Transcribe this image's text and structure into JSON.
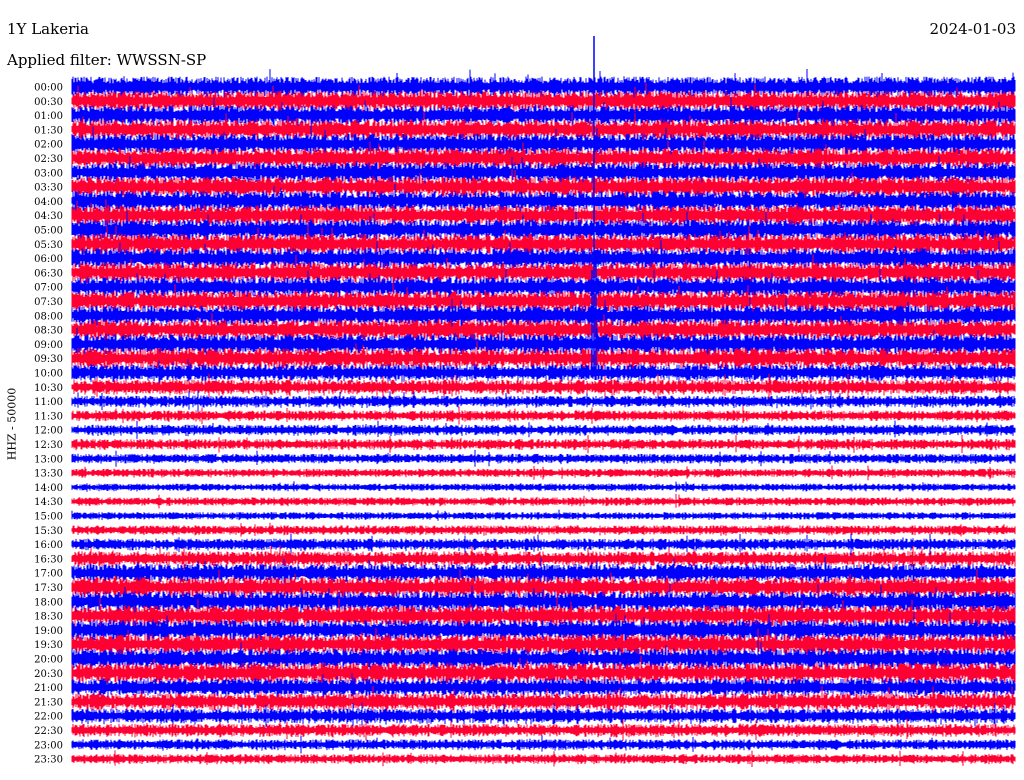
{
  "header": {
    "station": "1Y Lakeria",
    "date": "2024-01-03",
    "filter": "Applied filter: WWSSN-SP"
  },
  "chart_data": {
    "type": "line",
    "subtype": "helicorder",
    "ylabel": "HHZ - 50000",
    "row_labels": [
      "00:00",
      "00:30",
      "01:00",
      "01:30",
      "02:00",
      "02:30",
      "03:00",
      "03:30",
      "04:00",
      "04:30",
      "05:00",
      "05:30",
      "06:00",
      "06:30",
      "07:00",
      "07:30",
      "08:00",
      "08:30",
      "09:00",
      "09:30",
      "10:00",
      "10:30",
      "11:00",
      "11:30",
      "12:00",
      "12:30",
      "13:00",
      "13:30",
      "14:00",
      "14:30",
      "15:00",
      "15:30",
      "16:00",
      "16:30",
      "17:00",
      "17:30",
      "18:00",
      "18:30",
      "19:00",
      "19:30",
      "20:00",
      "20:30",
      "21:00",
      "21:30",
      "22:00",
      "22:30",
      "23:00",
      "23:30"
    ],
    "row_amplitude": [
      0.95,
      0.95,
      0.95,
      0.95,
      0.95,
      0.95,
      0.95,
      0.95,
      0.95,
      0.95,
      0.95,
      0.95,
      0.95,
      0.95,
      0.95,
      0.95,
      0.95,
      0.95,
      0.95,
      0.95,
      0.8,
      0.7,
      0.55,
      0.5,
      0.5,
      0.5,
      0.45,
      0.4,
      0.35,
      0.4,
      0.35,
      0.45,
      0.55,
      0.7,
      0.85,
      0.95,
      0.95,
      0.95,
      0.95,
      0.95,
      0.95,
      0.95,
      0.85,
      0.8,
      0.7,
      0.6,
      0.5,
      0.45
    ],
    "colors": [
      "#0000ff",
      "#ff0033"
    ],
    "grid": false
  }
}
